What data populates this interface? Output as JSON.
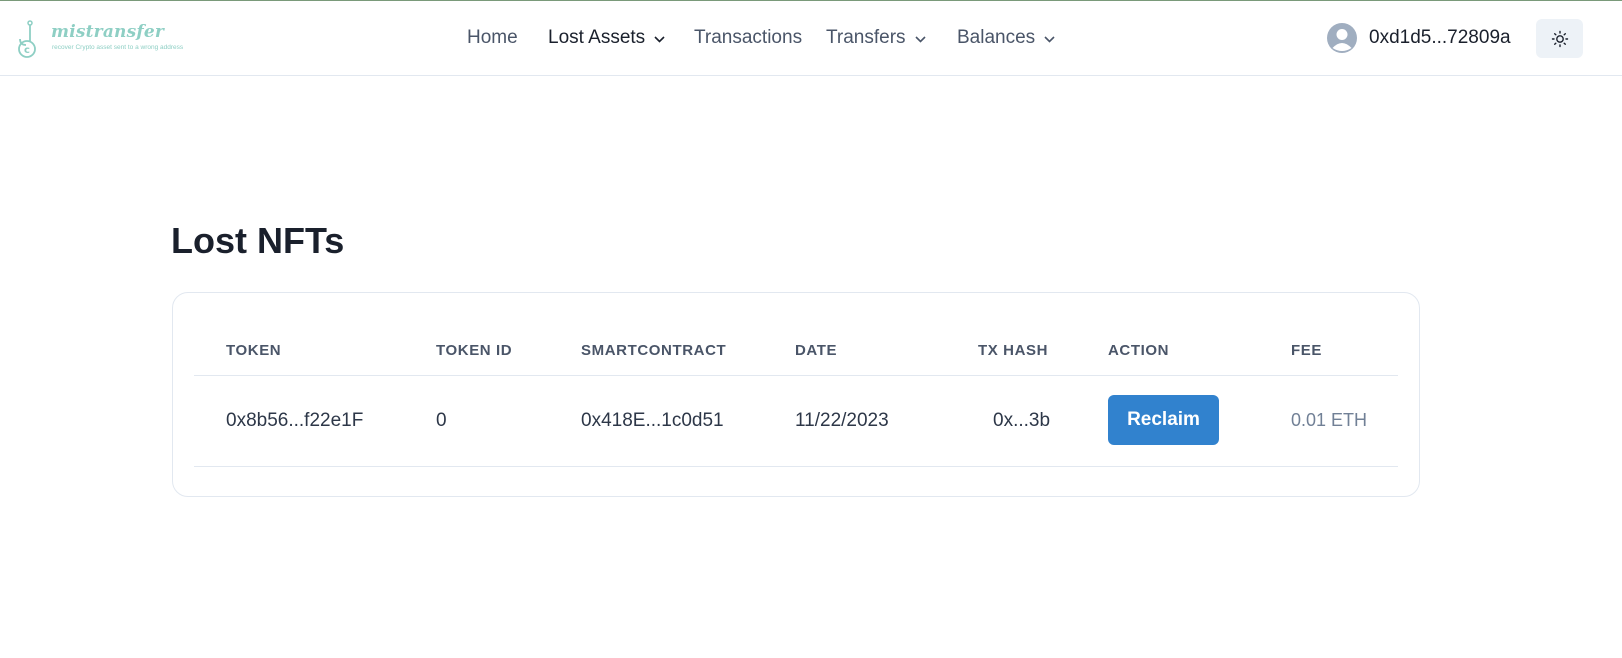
{
  "brand": {
    "name": "mistransfer",
    "tagline": "recover Crypto asset sent to a wrong address"
  },
  "nav": {
    "home": "Home",
    "lost_assets": "Lost Assets",
    "transactions": "Transactions",
    "transfers": "Transfers",
    "balances": "Balances"
  },
  "account": {
    "address": "0xd1d5...72809a"
  },
  "page": {
    "title": "Lost NFTs"
  },
  "table": {
    "headers": {
      "token": "TOKEN",
      "token_id": "TOKEN ID",
      "smartcontract": "SMARTCONTRACT",
      "date": "DATE",
      "tx_hash": "TX HASH",
      "action": "ACTION",
      "fee": "FEE"
    },
    "rows": [
      {
        "token": "0x8b56...f22e1F",
        "token_id": "0",
        "smartcontract": "0x418E...1c0d51",
        "date": "11/22/2023",
        "tx_hash": "0x...3b",
        "action": "Reclaim",
        "fee": "0.01 ETH"
      }
    ]
  },
  "icons": {
    "logo": "anchor-coin-icon",
    "avatar": "user-avatar-icon",
    "theme": "sun-icon",
    "dropdown": "chevron-down-icon"
  },
  "colors": {
    "brand": "#8ecfc4",
    "primary_button": "#3182ce",
    "text": "#1a202c"
  }
}
